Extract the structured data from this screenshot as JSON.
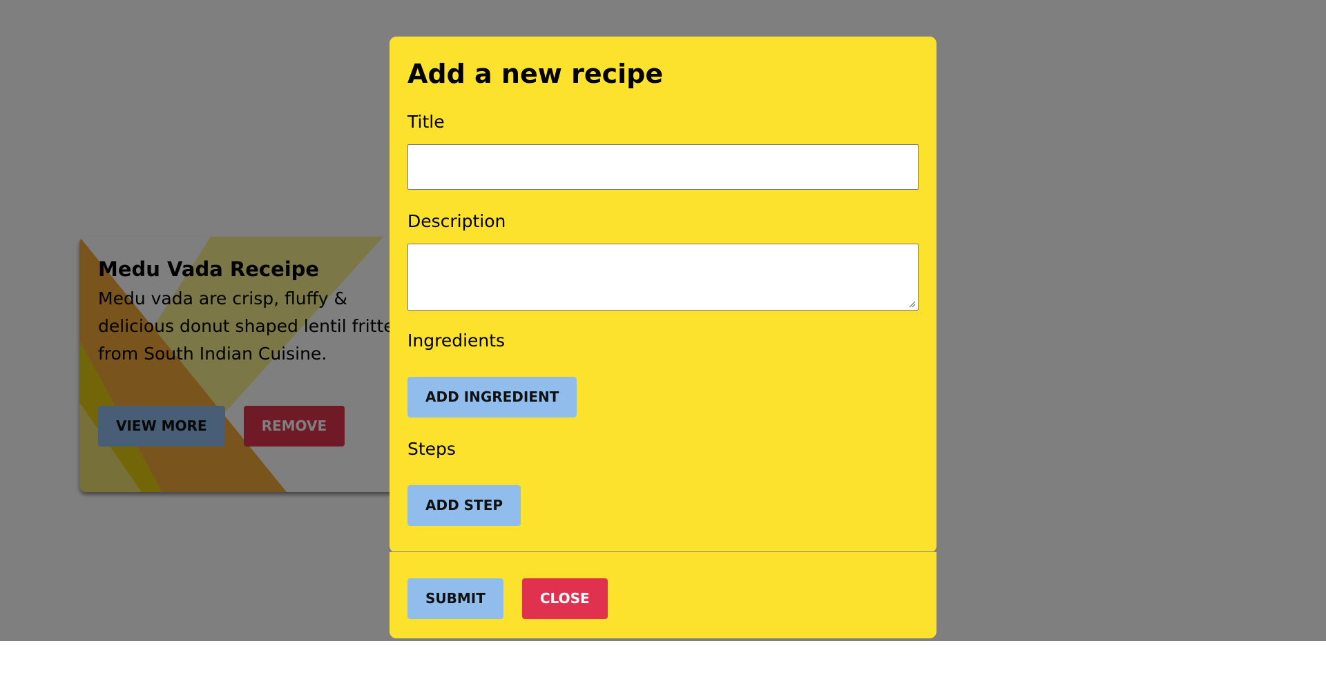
{
  "card": {
    "title": "Medu Vada Receipe",
    "description": "Medu vada are crisp, fluffy & delicious donut shaped lentil fritters from South Indian Cuisine.",
    "view_more_label": "VIEW MORE",
    "remove_label": "REMOVE"
  },
  "modal": {
    "title": "Add a new recipe",
    "title_label": "Title",
    "title_value": "",
    "description_label": "Description",
    "description_value": "",
    "ingredients_label": "Ingredients",
    "add_ingredient_label": "ADD INGREDIENT",
    "steps_label": "Steps",
    "add_step_label": "ADD STEP",
    "submit_label": "SUBMIT",
    "close_label": "CLOSE"
  },
  "colors": {
    "modal_bg": "#fde22d",
    "primary_button": "#90bdec",
    "danger_button": "#e0324f",
    "overlay": "rgba(0,0,0,0.5)"
  },
  "icons": {
    "textarea_resize": "resize-handle-icon"
  }
}
